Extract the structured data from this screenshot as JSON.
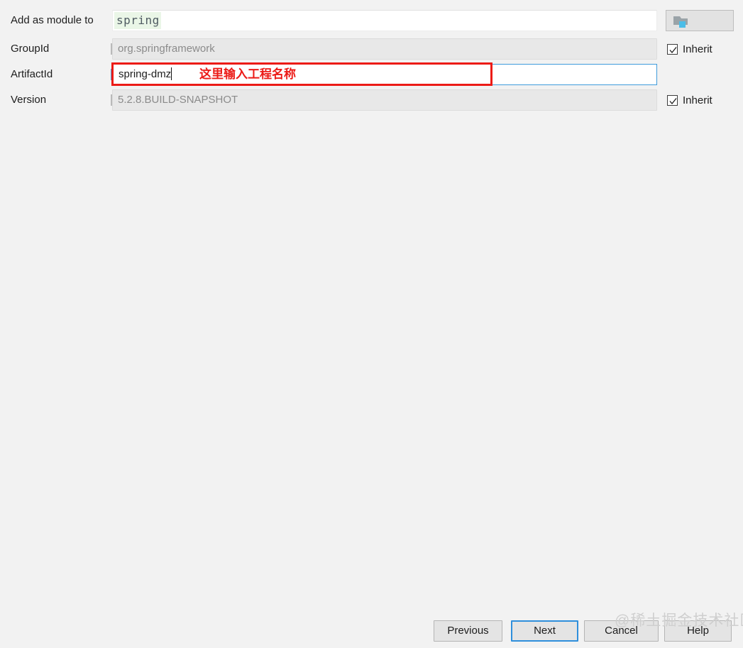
{
  "form": {
    "rows": [
      {
        "label": "Add as module to",
        "value": "spring",
        "kind": "combo"
      },
      {
        "label": "GroupId",
        "value": "org.springframework",
        "kind": "disabled"
      },
      {
        "label": "ArtifactId",
        "value": "spring-dmz",
        "kind": "active"
      },
      {
        "label": "Version",
        "value": "5.2.8.BUILD-SNAPSHOT",
        "kind": "disabled"
      }
    ]
  },
  "annotation": {
    "text": "这里输入工程名称",
    "color": "#ec1b17"
  },
  "right_column": {
    "module_icon": "folder-module-icon",
    "inherit_groupid_label": "Inherit",
    "inherit_groupid_checked": true,
    "inherit_version_label": "Inherit",
    "inherit_version_checked": true
  },
  "buttons": {
    "previous": "Previous",
    "next": "Next",
    "cancel": "Cancel",
    "help": "Help",
    "focused": "Next",
    "focus_color": "#2f8fdc"
  },
  "watermark": {
    "text": "@稀土掘金技术社区"
  },
  "colors": {
    "background": "#f2f2f2",
    "accent_blue": "#3f9bdc",
    "annotation_red": "#ec1b17",
    "token_highlight": "#eaf6e7"
  }
}
